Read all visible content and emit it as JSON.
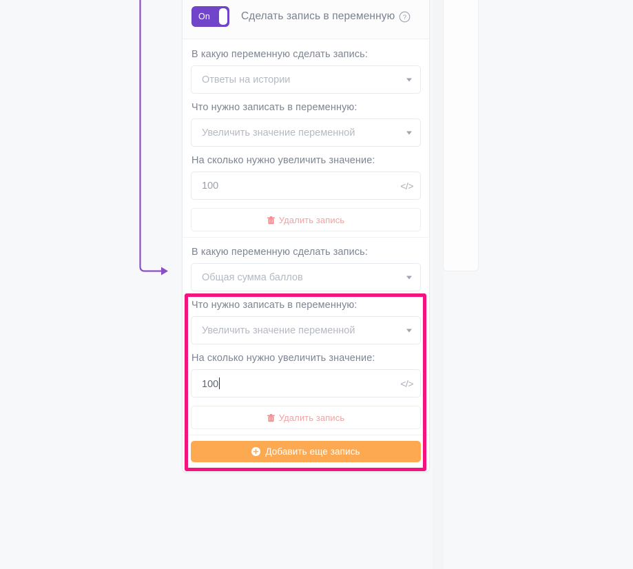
{
  "node": {
    "toggle_label": "On",
    "title": "Сделать запись в переменную",
    "help_icon": "question-circle-icon"
  },
  "groups": [
    {
      "variable_label": "В какую переменную сделать запись:",
      "variable_value": "Ответы на истории",
      "action_label": "Что нужно записать в переменную:",
      "action_value": "Увеличить значение переменной",
      "amount_label": "На сколько нужно увеличить значение:",
      "amount_value": "100",
      "amount_focused": false,
      "delete_label": "Удалить запись",
      "code_icon": "code-brackets-icon",
      "trash_icon": "trash-icon",
      "chevron_icon": "chevron-down-icon",
      "highlighted": false
    },
    {
      "variable_label": "В какую переменную сделать запись:",
      "variable_value": "Общая сумма баллов",
      "action_label": "Что нужно записать в переменную:",
      "action_value": "Увеличить значение переменной",
      "amount_label": "На сколько нужно увеличить значение:",
      "amount_value": "100",
      "amount_focused": true,
      "delete_label": "Удалить запись",
      "code_icon": "code-brackets-icon",
      "trash_icon": "trash-icon",
      "chevron_icon": "chevron-down-icon",
      "highlighted": true
    }
  ],
  "footer": {
    "add_label": "Добавить еще запись",
    "plus_icon": "plus-circle-icon"
  },
  "colors": {
    "toggle_on": "#7145c9",
    "highlight_border": "#f5147f",
    "add_button": "#fca951",
    "delete_text": "#f0a3a3",
    "connector": "#8b4fc4",
    "page_background": "#f7f8fa"
  }
}
